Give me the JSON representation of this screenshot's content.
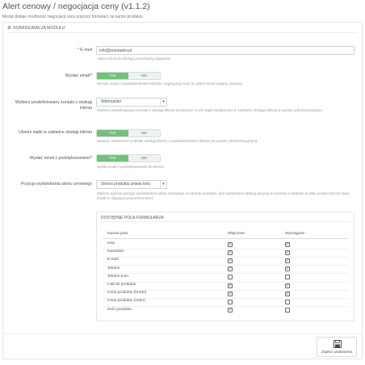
{
  "header": {
    "title": "Alert cenowy / negocjacja ceny (v1.1.2)",
    "subtitle": "Moduł dodaje możliwość negocjacji ceny poprzez formularz na karcie produktu"
  },
  "panel": {
    "heading": "KONFIGURACJA MODUŁU",
    "icon": "cog-icon"
  },
  "form": {
    "email": {
      "required_mark": "*",
      "label": "E-mail",
      "value": "info@prestadev.pl",
      "help": "Adres email do którego przychodzą zapytania"
    },
    "send_email": {
      "label": "Wysłać email?",
      "on": "TAK",
      "off": "NIE",
      "selected": "TAK",
      "help": "Wysyła email z powiadomieniem klienta / negocjacją ceny na adres email podany powyżej"
    },
    "default_contact": {
      "label": "Wybierz predefiniowany kontakt z obsługi klienta",
      "value": "Webmaster",
      "help": "Wybierz predefiniowany kontakt z obsługi klienta by tworzyć w nim wątki wiadomości w zakładce obsługa klienta w panelu administracyjnym."
    },
    "create_thread": {
      "label": "Utwórz wątki w zakładce obsługi klienta",
      "on": "TAK",
      "off": "NIE",
      "selected": "TAK",
      "help": "Utworzy wiadomość w dziale obsługi klienta z powiadomieniem klienta (w panelu administracyjnym)"
    },
    "thank_email": {
      "label": "Wysłać email z podziękowaniem?",
      "on": "TAK",
      "off": "NIE",
      "selected": "TAK",
      "help": "Wyśle email z podziękowaniem do klienta"
    },
    "alert_position": {
      "label": "Pozycja wyświetlania alertu cenowego",
      "value": "Strona produktu prawa kolu",
      "help": "Możesz wybrać pozycję wyświetlania alertu cenowego na stronie produktu, jeśli wybierzesz własną pozycję to prosimy o dodanie w pliku product.tpl hm kodu: {hook h='displayCustomPriceAlert'}"
    }
  },
  "fields_table": {
    "title": "DOSTĘPNE POLA FORMULARZA",
    "col_name": "Nazwa pola",
    "col_enabled": "Włączone",
    "col_required": "Wymagane",
    "rows": [
      {
        "name": "Imię",
        "enabled": true,
        "required": true
      },
      {
        "name": "Nazwisko",
        "enabled": true,
        "required": true
      },
      {
        "name": "E-mail",
        "enabled": true,
        "required": true
      },
      {
        "name": "Telefon",
        "enabled": true,
        "required": true
      },
      {
        "name": "Telefon kom.",
        "enabled": false,
        "required": false
      },
      {
        "name": "Link do produktu",
        "enabled": true,
        "required": true
      },
      {
        "name": "Cena produktu (brutto)",
        "enabled": true,
        "required": true
      },
      {
        "name": "Cena produktu (netto)",
        "enabled": false,
        "required": false
      },
      {
        "name": "Ilość produktu",
        "enabled": true,
        "required": false
      }
    ]
  },
  "footer": {
    "save_label": "Zapisz ustawienia",
    "save_icon": "save-disk-icon"
  },
  "colors": {
    "switch_on": "#72c279",
    "required_mark": "#e0514a",
    "input_border": "#c7d6db"
  }
}
